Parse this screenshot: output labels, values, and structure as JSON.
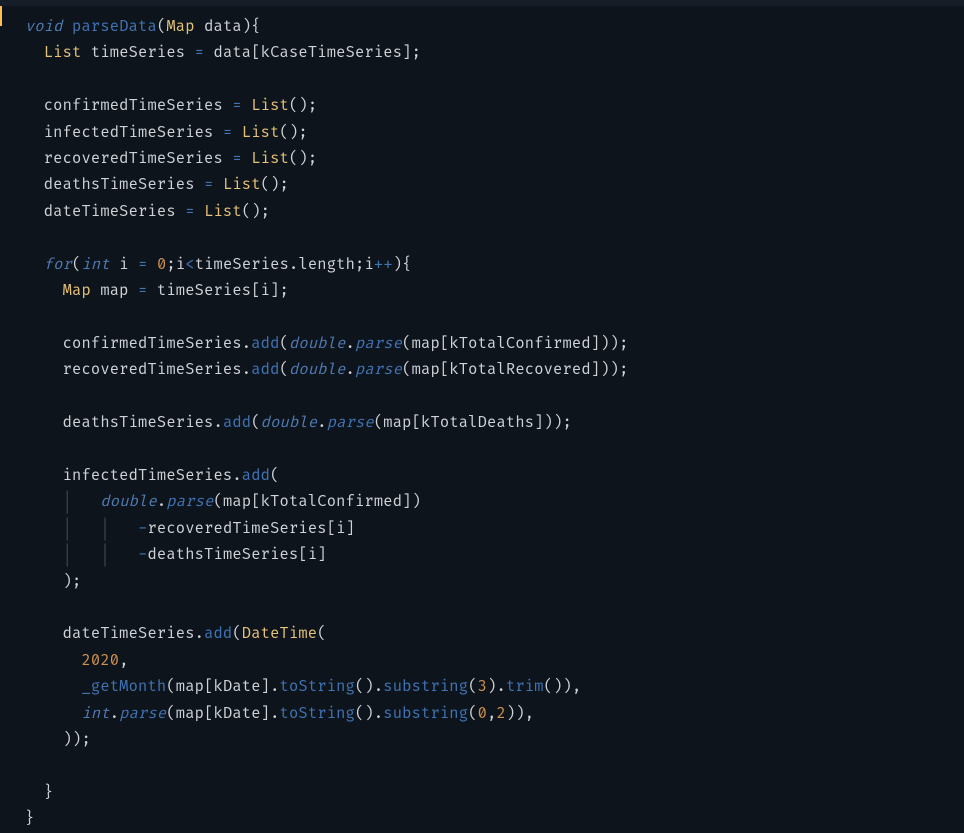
{
  "code": {
    "line1": {
      "kw_void": "void",
      "fn": "parseData",
      "lp": "(",
      "type_map": "Map",
      "param": "data",
      "rp": ")",
      "lb": "{"
    },
    "line2": {
      "indent": "    ",
      "type_list": "List",
      "ident": "timeSeries",
      "op": " = ",
      "rhs": "data",
      "lbr": "[",
      "key": "kCaseTimeSeries",
      "rbr": "]",
      "semi": ";"
    },
    "line3": "",
    "line4": {
      "indent": "    ",
      "ident": "confirmedTimeSeries",
      "op": " = ",
      "ctor": "List",
      "paren": "()",
      "semi": ";"
    },
    "line5": {
      "indent": "    ",
      "ident": "infectedTimeSeries",
      "op": " = ",
      "ctor": "List",
      "paren": "()",
      "semi": ";"
    },
    "line6": {
      "indent": "    ",
      "ident": "recoveredTimeSeries",
      "op": " = ",
      "ctor": "List",
      "paren": "()",
      "semi": ";"
    },
    "line7": {
      "indent": "    ",
      "ident": "deathsTimeSeries",
      "op": " = ",
      "ctor": "List",
      "paren": "()",
      "semi": ";"
    },
    "line8": {
      "indent": "    ",
      "ident": "dateTimeSeries",
      "op": " = ",
      "ctor": "List",
      "paren": "()",
      "semi": ";"
    },
    "line9": "",
    "line10": {
      "indent": "    ",
      "kw_for": "for",
      "lp": "(",
      "kt_int": "int",
      "i": " i ",
      "eq": "= ",
      "zero": "0",
      "semi1": ";",
      "cond_i": "i",
      "lt": "<",
      "ts": "timeSeries",
      "dot": ".",
      "len": "length",
      "semi2": ";",
      "ipp_i": "i",
      "pp": "++",
      "rp": ")",
      "lb": "{"
    },
    "line11": {
      "indent": "      ",
      "type_map": "Map",
      "ident": " map ",
      "eq": "= ",
      "rhs": "timeSeries",
      "lbr": "[",
      "i": "i",
      "rbr": "]",
      "semi": ";"
    },
    "line12": "",
    "line13": {
      "indent": "      ",
      "ident": "confirmedTimeSeries",
      "dot1": ".",
      "add": "add",
      "lp1": "(",
      "dbl": "double",
      "dot2": ".",
      "parse": "parse",
      "lp2": "(",
      "map": "map",
      "lbr": "[",
      "key": "kTotalConfirmed",
      "rbr": "]",
      "rp": "));"
    },
    "line14": {
      "indent": "      ",
      "ident": "recoveredTimeSeries",
      "dot1": ".",
      "add": "add",
      "lp1": "(",
      "dbl": "double",
      "dot2": ".",
      "parse": "parse",
      "lp2": "(",
      "map": "map",
      "lbr": "[",
      "key": "kTotalRecovered",
      "rbr": "]",
      "rp": "));"
    },
    "line15": "",
    "line16": {
      "indent": "      ",
      "ident": "deathsTimeSeries",
      "dot1": ".",
      "add": "add",
      "lp1": "(",
      "dbl": "double",
      "dot2": ".",
      "parse": "parse",
      "lp2": "(",
      "map": "map",
      "lbr": "[",
      "key": "kTotalDeaths",
      "rbr": "]",
      "rp": "));"
    },
    "line17": "",
    "line18": {
      "indent": "      ",
      "ident": "infectedTimeSeries",
      "dot1": ".",
      "add": "add",
      "lp1": "("
    },
    "line19": {
      "indent": "          ",
      "dbl": "double",
      "dot": ".",
      "parse": "parse",
      "lp": "(",
      "map": "map",
      "lbr": "[",
      "key": "kTotalConfirmed",
      "rbr": "]",
      "rp": ")"
    },
    "line20": {
      "indent": "              ",
      "minus": "-",
      "ident": "recoveredTimeSeries",
      "lbr": "[",
      "i": "i",
      "rbr": "]"
    },
    "line21": {
      "indent": "              ",
      "minus": "-",
      "ident": "deathsTimeSeries",
      "lbr": "[",
      "i": "i",
      "rbr": "]"
    },
    "line22": {
      "indent": "      ",
      "rp": ");"
    },
    "line23": "",
    "line24": {
      "indent": "      ",
      "ident": "dateTimeSeries",
      "dot1": ".",
      "add": "add",
      "lp1": "(",
      "ctor": "DateTime",
      "lp2": "("
    },
    "line25": {
      "indent": "        ",
      "num": "2020",
      "comma": ","
    },
    "line26": {
      "indent": "        ",
      "fn": "_getMonth",
      "lp": "(",
      "map": "map",
      "lbr": "[",
      "key": "kDate",
      "rbr": "]",
      "dot1": ".",
      "tostr": "toString",
      "p1": "().",
      "sub": "substring",
      "lp2": "(",
      "n3": "3",
      "rp2": ").",
      "trim": "trim",
      "tail": "()),"
    },
    "line27": {
      "indent": "        ",
      "kt_int": "int",
      "dot": ".",
      "parse": "parse",
      "lp": "(",
      "map": "map",
      "lbr": "[",
      "key": "kDate",
      "rbr": "]",
      "dot1": ".",
      "tostr": "toString",
      "p1": "().",
      "sub": "substring",
      "lp2": "(",
      "n0": "0",
      "comma": ",",
      "n2": "2",
      "tail": ")),"
    },
    "line28": {
      "indent": "      ",
      "rp": "));"
    },
    "line29": "",
    "line30": {
      "indent": "    ",
      "rb": "}"
    },
    "line31": {
      "indent": "  ",
      "rb": "}"
    }
  }
}
